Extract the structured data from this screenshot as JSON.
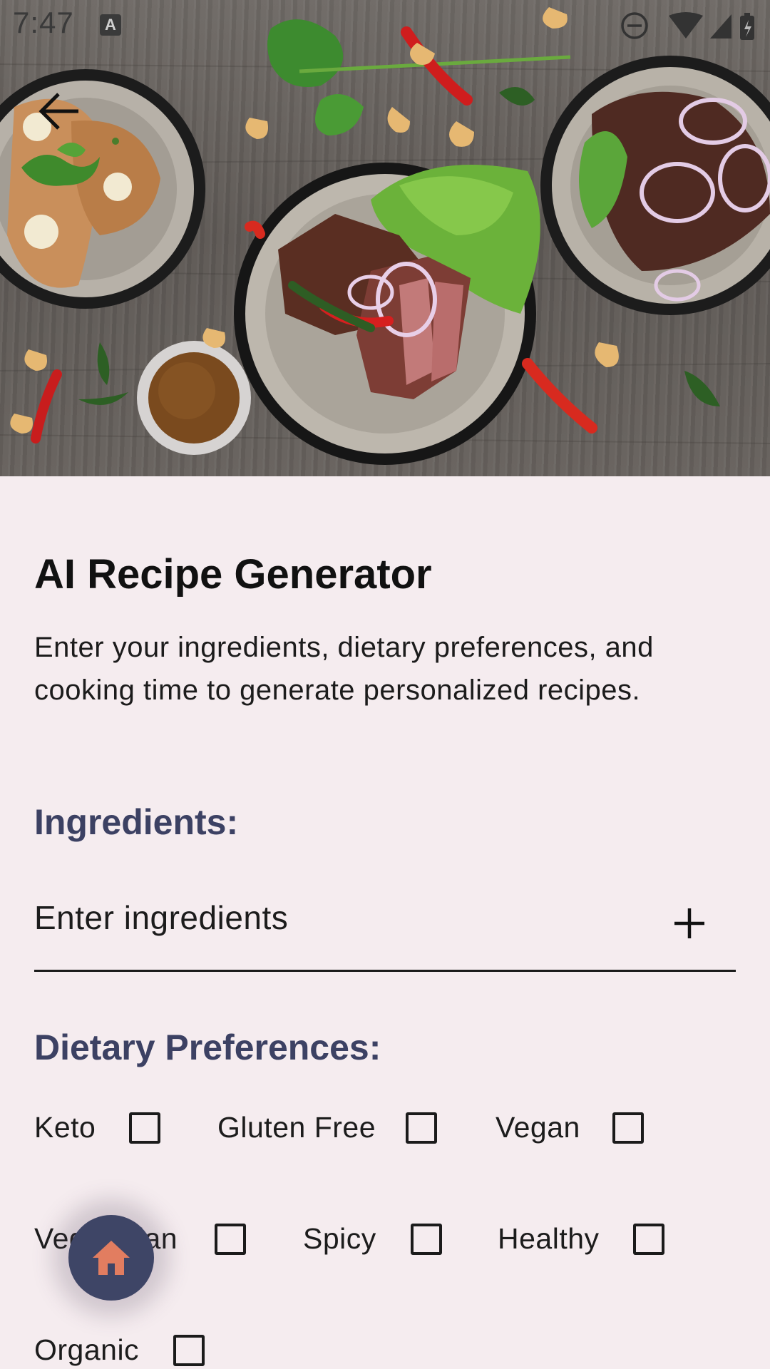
{
  "status_bar": {
    "time": "7:47",
    "app_icon": "A"
  },
  "hero": {
    "description": "food-bowls-image",
    "back_icon": "arrow-left-icon"
  },
  "page": {
    "title": "AI Recipe Generator",
    "description": "Enter your ingredients, dietary preferences, and cooking time to generate personalized recipes."
  },
  "ingredients": {
    "heading": "Ingredients:",
    "placeholder": "Enter ingredients",
    "add_icon": "plus-icon"
  },
  "dietary": {
    "heading": "Dietary Preferences:",
    "options": [
      {
        "label": "Keto",
        "checked": false
      },
      {
        "label": "Gluten Free",
        "checked": false
      },
      {
        "label": "Vegan",
        "checked": false
      },
      {
        "label": "Vegetarian",
        "checked": false
      },
      {
        "label": "Spicy",
        "checked": false
      },
      {
        "label": "Healthy",
        "checked": false
      },
      {
        "label": "Organic",
        "checked": false
      }
    ]
  },
  "fab": {
    "icon": "home-icon"
  },
  "colors": {
    "background": "#f5ecef",
    "heading": "#3c4163",
    "fab": "#3e4566",
    "fab_icon": "#e27d60"
  }
}
